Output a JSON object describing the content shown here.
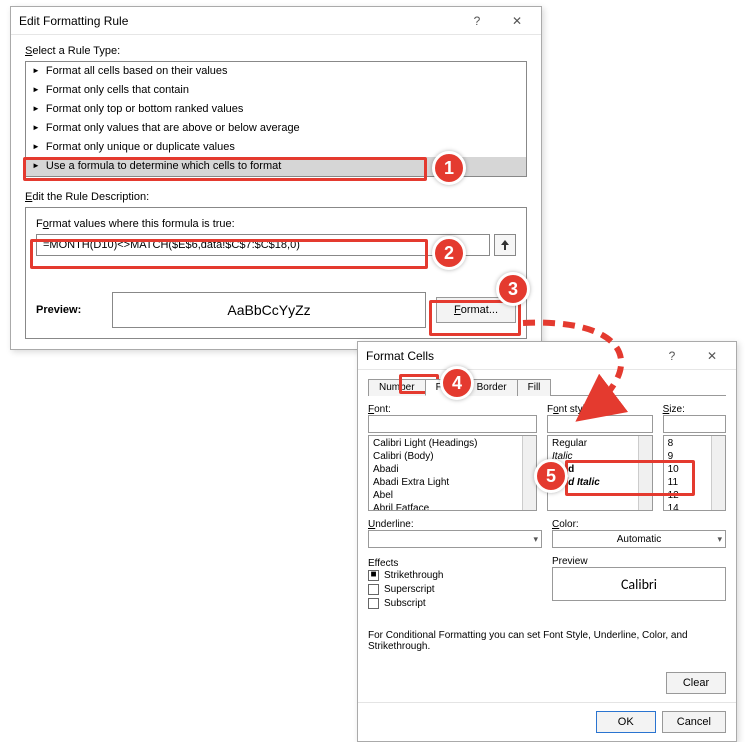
{
  "editRule": {
    "title": "Edit Formatting Rule",
    "selectRuleTypeLabel": "Select a Rule Type:",
    "ruleTypes": [
      "Format all cells based on their values",
      "Format only cells that contain",
      "Format only top or bottom ranked values",
      "Format only values that are above or below average",
      "Format only unique or duplicate values",
      "Use a formula to determine which cells to format"
    ],
    "selectedRuleIndex": 5,
    "editDescLabel": "Edit the Rule Description:",
    "formulaLabel": "Format values where this formula is true:",
    "formula": "=MONTH(D10)<>MATCH($E$6,data!$C$7:$C$18,0)",
    "previewLabel": "Preview:",
    "previewSample": "AaBbCcYyZz",
    "formatButton": "Format..."
  },
  "formatCells": {
    "title": "Format Cells",
    "tabs": [
      "Number",
      "Font",
      "Border",
      "Fill"
    ],
    "activeTab": 1,
    "fontLabel": "Font:",
    "fonts": [
      "Calibri Light (Headings)",
      "Calibri (Body)",
      "Abadi",
      "Abadi Extra Light",
      "Abel",
      "Abril Fatface"
    ],
    "fontStyleLabel": "Font style:",
    "fontStyles": [
      "Regular",
      "Italic",
      "Bold",
      "Bold Italic"
    ],
    "sizeLabel": "Size:",
    "sizes": [
      "8",
      "9",
      "10",
      "11",
      "12",
      "14"
    ],
    "underlineLabel": "Underline:",
    "underlineValue": "",
    "colorLabel": "Color:",
    "colorValue": "Automatic",
    "effectsLabel": "Effects",
    "strike": "Strikethrough",
    "superscript": "Superscript",
    "subscript": "Subscript",
    "previewLabel": "Preview",
    "previewFont": "Calibri",
    "note": "For Conditional Formatting you can set Font Style, Underline, Color, and Strikethrough.",
    "clear": "Clear",
    "ok": "OK",
    "cancel": "Cancel"
  },
  "badges": {
    "b1": "1",
    "b2": "2",
    "b3": "3",
    "b4": "4",
    "b5": "5"
  }
}
